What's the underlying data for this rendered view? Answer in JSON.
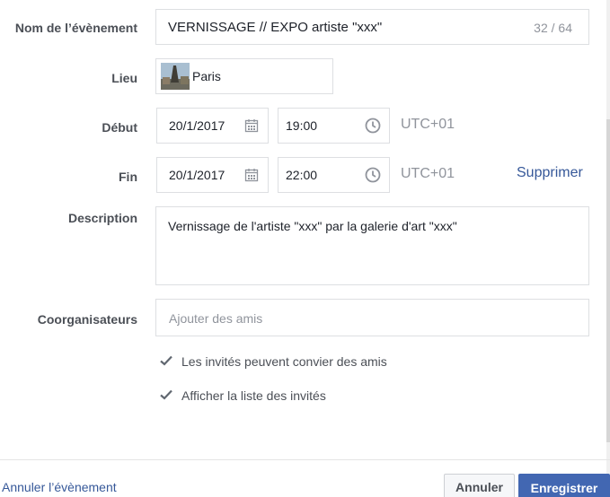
{
  "fields": {
    "name_label": "Nom de l’évènement",
    "name_value": "VERNISSAGE // EXPO artiste \"xxx\"",
    "name_counter": "32 / 64",
    "location_label": "Lieu",
    "location_value": "Paris",
    "start_label": "Début",
    "start_date": "20/1/2017",
    "start_time": "19:00",
    "start_tz": "UTC+01",
    "end_label": "Fin",
    "end_date": "20/1/2017",
    "end_time": "22:00",
    "end_tz": "UTC+01",
    "remove_link": "Supprimer",
    "description_label": "Description",
    "description_value": "Vernissage de l'artiste \"xxx\" par la galerie d'art \"xxx\"",
    "coorganizers_label": "Coorganisateurs",
    "coorganizers_placeholder": "Ajouter des amis"
  },
  "options": [
    {
      "label": "Les invités peuvent convier des amis",
      "checked": true
    },
    {
      "label": "Afficher la liste des invités",
      "checked": true
    }
  ],
  "footer": {
    "cancel_event_link": "Annuler l’évènement",
    "cancel_button": "Annuler",
    "save_button": "Enregistrer"
  },
  "icons": {
    "calendar": "calendar-icon",
    "clock": "clock-icon",
    "check": "checkmark-icon",
    "location_thumbnail": "paris-thumbnail"
  },
  "colors": {
    "link": "#365899",
    "primary_button": "#4267b2",
    "border": "#dddfe2",
    "label": "#4b4f56",
    "muted": "#90949c"
  }
}
